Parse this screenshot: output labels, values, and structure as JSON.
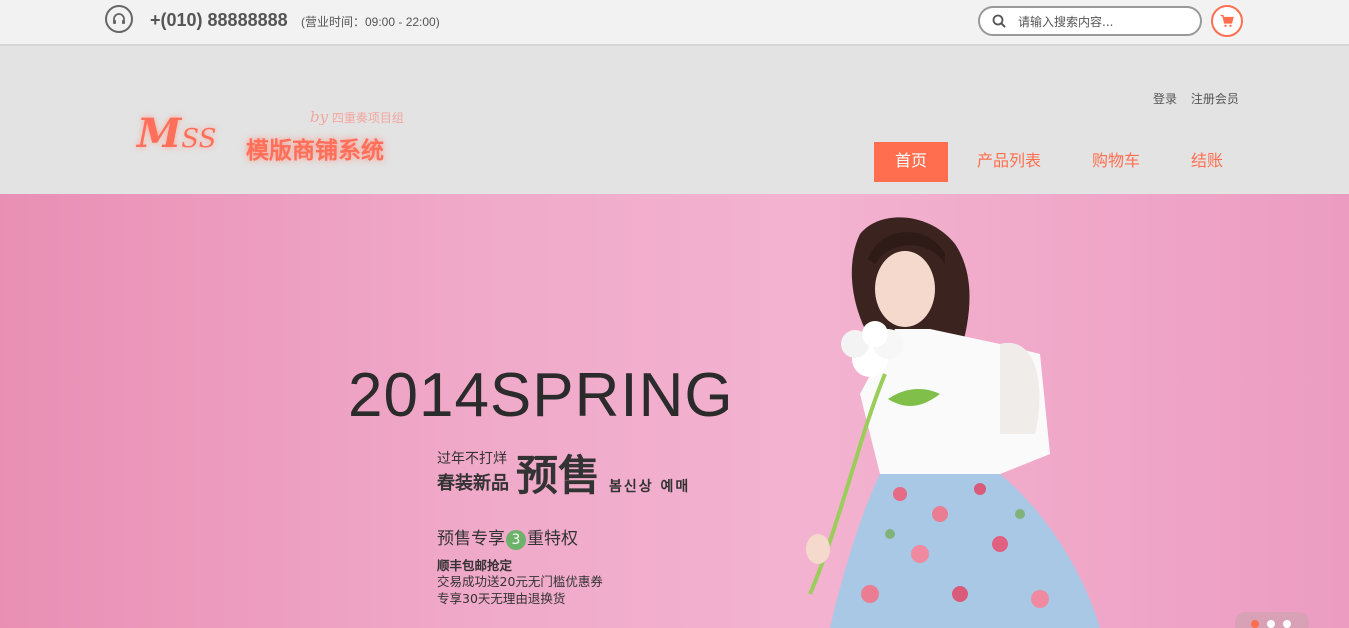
{
  "topbar": {
    "phone": "+(010) 88888888",
    "hours": "(营业时间：09:00 - 22:00)",
    "search_placeholder": "请输入搜索内容...",
    "icons": [
      "headphone-icon",
      "search-icon",
      "cart-icon"
    ]
  },
  "brand": {
    "logo_big": "M",
    "logo_small": "SS",
    "name": "模版商铺系统",
    "by": "by",
    "team": "四重奏项目组"
  },
  "user_links": {
    "login": "登录",
    "register": "注册会员"
  },
  "nav": [
    {
      "label": "首页",
      "active": true
    },
    {
      "label": "产品列表",
      "active": false
    },
    {
      "label": "购物车",
      "active": false
    },
    {
      "label": "结账",
      "active": false
    }
  ],
  "banner": {
    "headline": "2014SPRING",
    "line1": "过年不打烊",
    "line2": "春装新品",
    "presale": "预售",
    "korean": "봄신상 예매",
    "privilege_before": "预售专享",
    "privilege_num": "3",
    "privilege_after": "重特权",
    "perk1": "顺丰包邮抢定",
    "perk2": "交易成功送20元无门槛优惠券",
    "perk3": "专享30天无理由退换货"
  },
  "colors": {
    "accent": "#ff6f4f",
    "banner_pink": "#f0a9c9"
  }
}
